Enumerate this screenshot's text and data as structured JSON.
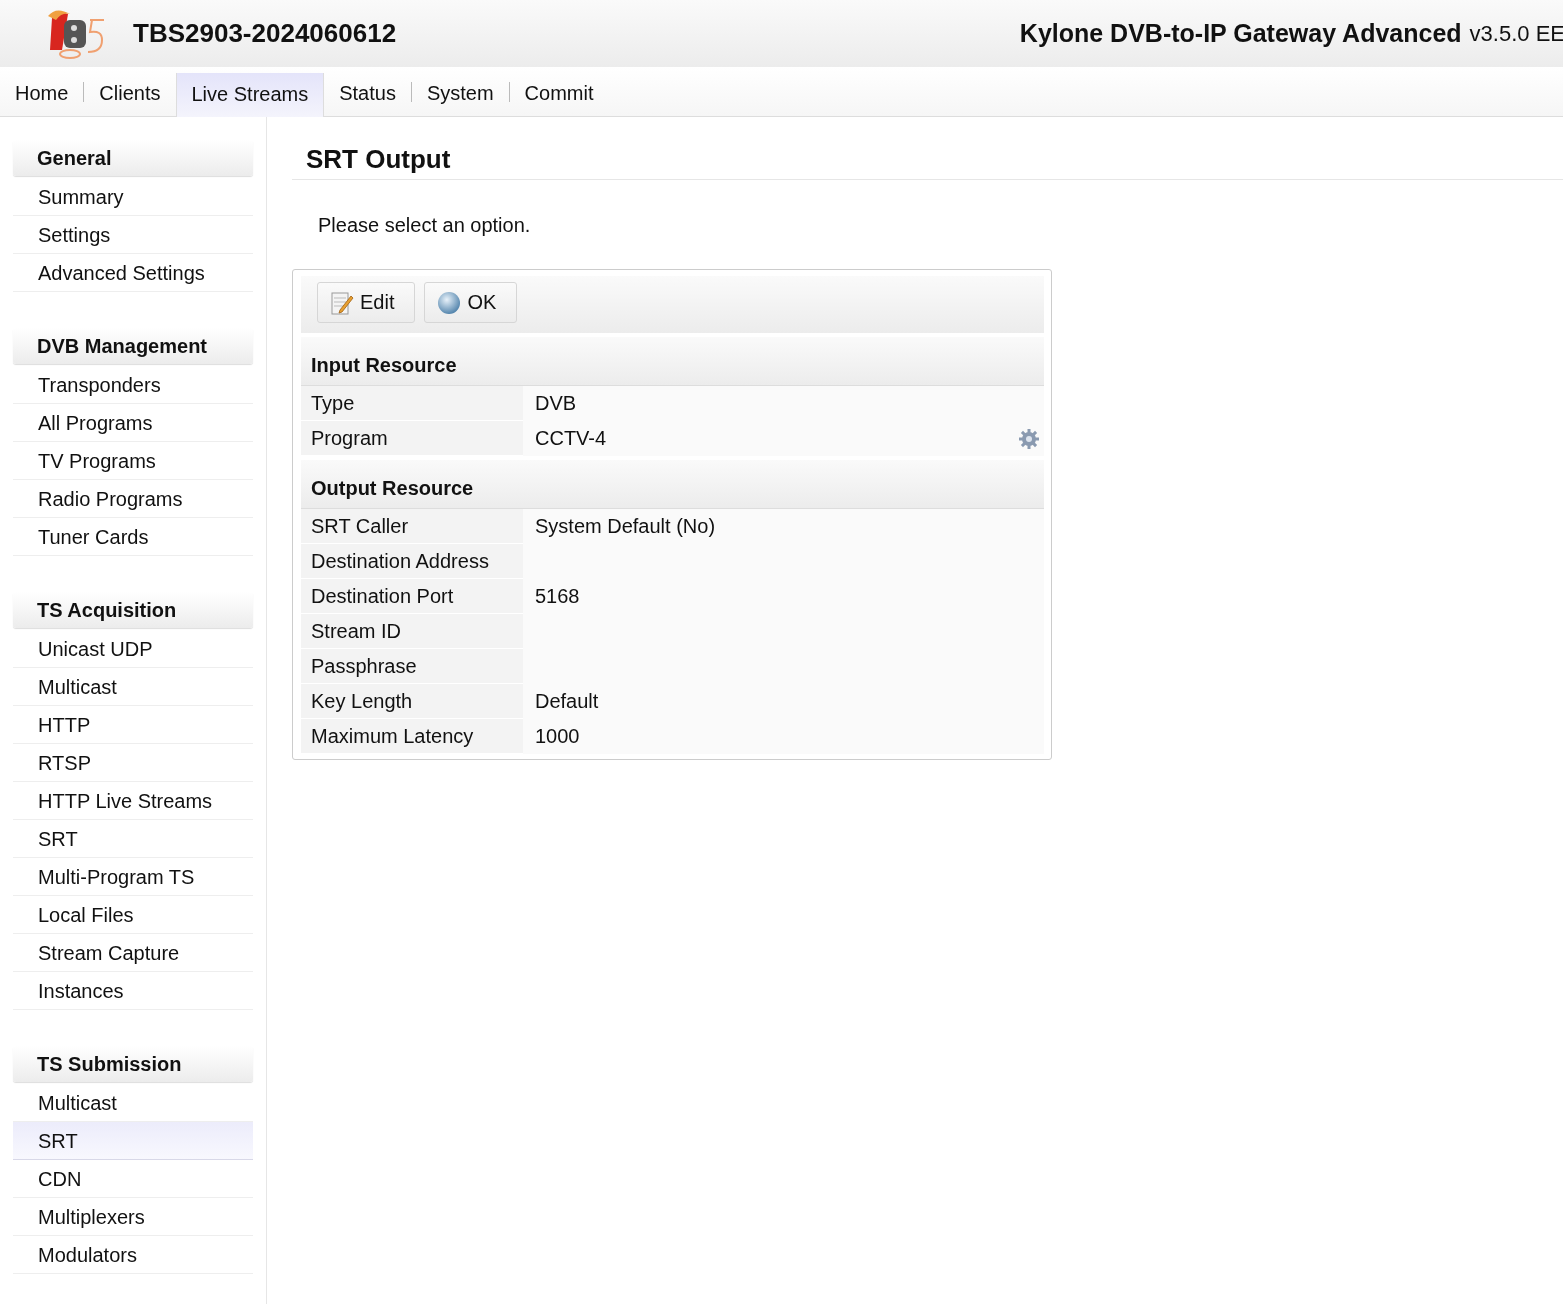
{
  "header": {
    "device_name": "TBS2903-2024060612",
    "product_name": "Kylone DVB-to-IP Gateway Advanced",
    "version": "v3.5.0 EE"
  },
  "nav": [
    {
      "label": "Home",
      "selected": false
    },
    {
      "label": "Clients",
      "selected": false
    },
    {
      "label": "Live Streams",
      "selected": true
    },
    {
      "label": "Status",
      "selected": false
    },
    {
      "label": "System",
      "selected": false
    },
    {
      "label": "Commit",
      "selected": false
    }
  ],
  "sidebar": [
    {
      "title": "General",
      "items": [
        {
          "label": "Summary",
          "selected": false
        },
        {
          "label": "Settings",
          "selected": false
        },
        {
          "label": "Advanced Settings",
          "selected": false
        }
      ]
    },
    {
      "title": "DVB Management",
      "items": [
        {
          "label": "Transponders",
          "selected": false
        },
        {
          "label": "All Programs",
          "selected": false
        },
        {
          "label": "TV Programs",
          "selected": false
        },
        {
          "label": "Radio Programs",
          "selected": false
        },
        {
          "label": "Tuner Cards",
          "selected": false
        }
      ]
    },
    {
      "title": "TS Acquisition",
      "items": [
        {
          "label": "Unicast UDP",
          "selected": false
        },
        {
          "label": "Multicast",
          "selected": false
        },
        {
          "label": "HTTP",
          "selected": false
        },
        {
          "label": "RTSP",
          "selected": false
        },
        {
          "label": "HTTP Live Streams",
          "selected": false
        },
        {
          "label": "SRT",
          "selected": false
        },
        {
          "label": "Multi-Program TS",
          "selected": false
        },
        {
          "label": "Local Files",
          "selected": false
        },
        {
          "label": "Stream Capture",
          "selected": false
        },
        {
          "label": "Instances",
          "selected": false
        }
      ]
    },
    {
      "title": "TS Submission",
      "items": [
        {
          "label": "Multicast",
          "selected": false
        },
        {
          "label": "SRT",
          "selected": true
        },
        {
          "label": "CDN",
          "selected": false
        },
        {
          "label": "Multiplexers",
          "selected": false
        },
        {
          "label": "Modulators",
          "selected": false
        }
      ]
    }
  ],
  "content": {
    "title": "SRT Output",
    "message": "Please select an option.",
    "toolbar": [
      {
        "label": "Edit",
        "kind": "edit"
      },
      {
        "label": "OK",
        "kind": "ok"
      }
    ],
    "sections": [
      {
        "title": "Input Resource",
        "rows": [
          {
            "label": "Type",
            "value": "DVB",
            "settings_button": false
          },
          {
            "label": "Program",
            "value": "CCTV-4",
            "settings_button": true
          }
        ]
      },
      {
        "title": "Output Resource",
        "rows": [
          {
            "label": "SRT Caller",
            "value": "System Default (No)",
            "settings_button": false
          },
          {
            "label": "Destination Address",
            "settings_button": false
          },
          {
            "label": "Destination Port",
            "value": "5168",
            "settings_button": false
          },
          {
            "label": "Stream ID",
            "settings_button": false
          },
          {
            "label": "Passphrase",
            "settings_button": false
          },
          {
            "label": "Key Length",
            "value": "Default",
            "settings_button": false
          },
          {
            "label": "Maximum Latency",
            "value": "1000",
            "settings_button": false
          }
        ]
      }
    ]
  }
}
